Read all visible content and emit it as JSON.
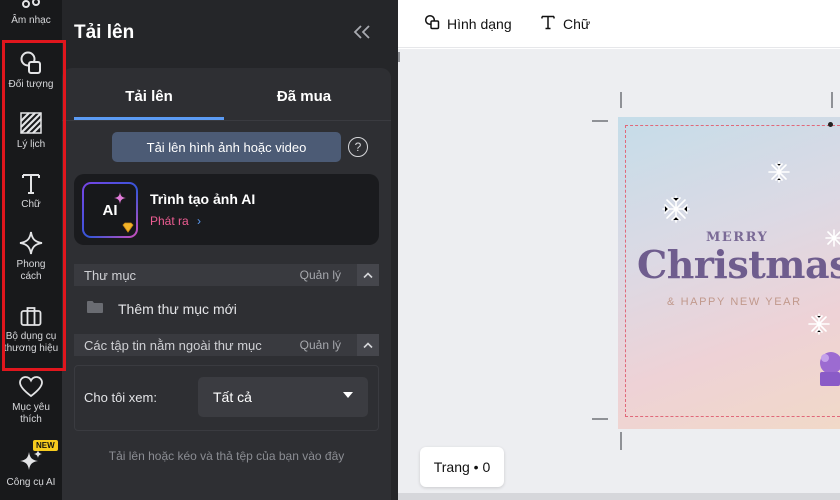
{
  "rail": {
    "items": [
      {
        "label": "Âm nhạc",
        "icon": "music-icon"
      },
      {
        "label": "Đối tượng",
        "icon": "shapes-icon"
      },
      {
        "label": "Lý lịch",
        "icon": "background-pattern-icon"
      },
      {
        "label": "Chữ",
        "icon": "text-icon"
      },
      {
        "label": "Phong\ncách",
        "icon": "sparkle-style-icon"
      },
      {
        "label": "Bộ dụng cụ\nthương hiệu",
        "icon": "briefcase-icon"
      },
      {
        "label": "Mục yêu\nthích",
        "icon": "heart-icon"
      },
      {
        "label": "Công cụ AI",
        "icon": "ai-sparkle-icon"
      }
    ],
    "new_badge": "NEW",
    "highlight_color": "#e0161d"
  },
  "panel": {
    "title": "Tải lên",
    "collapse_icon": "double-chevron-left-icon",
    "tabs": [
      {
        "label": "Tải lên",
        "active": true
      },
      {
        "label": "Đã mua",
        "active": false
      }
    ],
    "upload_button": "Tải lên hình ảnh hoặc video",
    "help": "?",
    "ai_card": {
      "thumb_text": "AI",
      "title": "Trình tạo ảnh AI",
      "link": "Phát ra"
    },
    "folders_section": {
      "title": "Thư mục",
      "manage": "Quản lý"
    },
    "add_folder": "Thêm thư mục mới",
    "outside_section": {
      "title": "Các tập tin nằm ngoài thư mục",
      "manage": "Quản lý"
    },
    "filter": {
      "label": "Cho tôi xem:",
      "selected": "Tất cả"
    },
    "drop_hint": "Tải lên hoặc kéo và thả tệp của bạn vào đây",
    "accent_color": "#5b9bf4",
    "link_color": "#ee5d93"
  },
  "toolbar": {
    "shape_label": "Hình dạng",
    "text_label": "Chữ"
  },
  "canvas": {
    "merry": "MERRY",
    "christmas": "Christmas",
    "happy_new_year": "& HAPPY NEW YEAR",
    "page_label": "Trang • 0"
  }
}
